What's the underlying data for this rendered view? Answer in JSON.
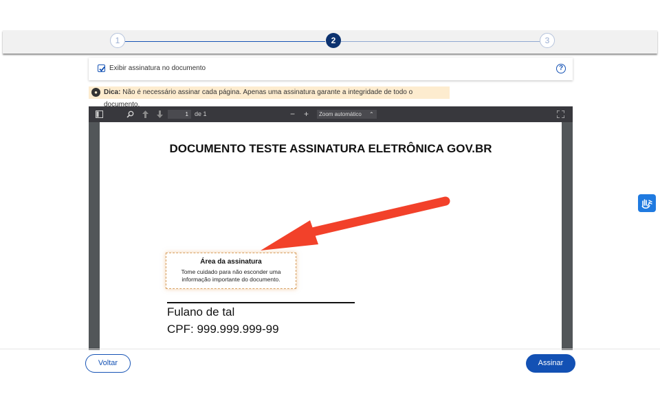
{
  "stepper": {
    "steps": [
      "1",
      "2",
      "3"
    ],
    "active_step": 2
  },
  "options": {
    "show_signature_label": "Exibir assinatura no documento",
    "show_signature_checked": true,
    "help_label": "?"
  },
  "tip": {
    "prefix": "Dica:",
    "text": "Não é necessário assinar cada página. Apenas uma assinatura garante a integridade de todo o documento."
  },
  "pdf_toolbar": {
    "page_value": "1",
    "page_of": "de 1",
    "zoom_minus": "−",
    "zoom_plus": "+",
    "zoom_label": "Zoom automático",
    "zoom_caret": "⌃"
  },
  "document": {
    "title": "DOCUMENTO TESTE ASSINATURA ELETRÔNICA GOV.BR",
    "signature_area_title": "Área da assinatura",
    "signature_area_desc_1": "Tome cuidado para não esconder uma",
    "signature_area_desc_2": "informação importante do documento.",
    "signer_name": "Fulano de tal",
    "signer_cpf": "CPF: 999.999.999-99"
  },
  "actions": {
    "back_label": "Voltar",
    "sign_label": "Assinar"
  },
  "colors": {
    "primary": "#1351b4",
    "step_active": "#0c326f",
    "tip_bg": "#fdeccf",
    "arrow": "#f2412a"
  }
}
